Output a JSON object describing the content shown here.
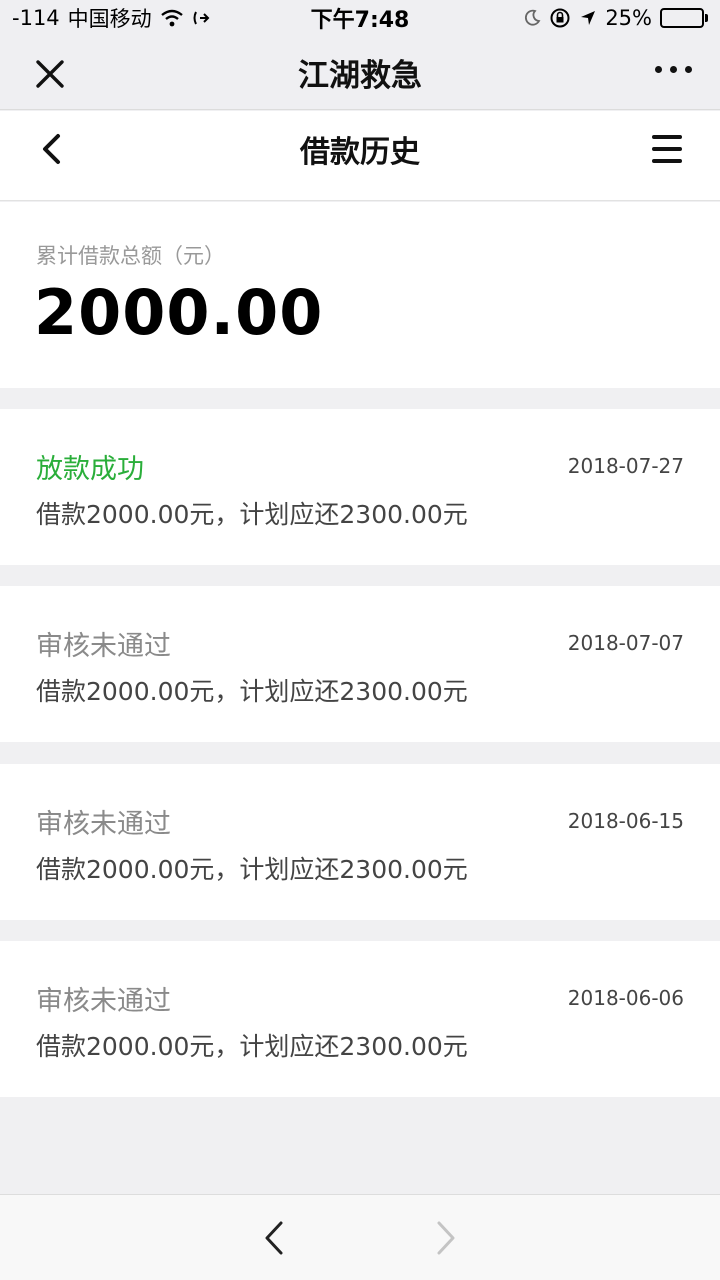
{
  "status_bar": {
    "signal": "-114",
    "carrier": "中国移动",
    "time": "下午7:48",
    "battery": "25%",
    "battery_level": 0.25
  },
  "wx_header": {
    "title": "江湖救急"
  },
  "page_header": {
    "title": "借款历史"
  },
  "summary": {
    "label": "累计借款总额（元）",
    "total": "2000.00"
  },
  "records": [
    {
      "status": "放款成功",
      "date": "2018-07-27",
      "desc": "借款2000.00元，计划应还2300.00元"
    },
    {
      "status": "审核未通过",
      "date": "2018-07-07",
      "desc": "借款2000.00元，计划应还2300.00元"
    },
    {
      "status": "审核未通过",
      "date": "2018-06-15",
      "desc": "借款2000.00元，计划应还2300.00元"
    },
    {
      "status": "审核未通过",
      "date": "2018-06-06",
      "desc": "借款2000.00元，计划应还2300.00元"
    }
  ],
  "colors": {
    "success": "#2aae3a",
    "rejected": "#8a8a8a",
    "background": "#f0f0f2"
  },
  "icons": {
    "close": "close-icon",
    "more": "more-dots-icon",
    "back": "chevron-left-icon",
    "menu": "hamburger-menu-icon",
    "nav_back": "browser-back-icon",
    "nav_forward": "browser-forward-icon"
  }
}
